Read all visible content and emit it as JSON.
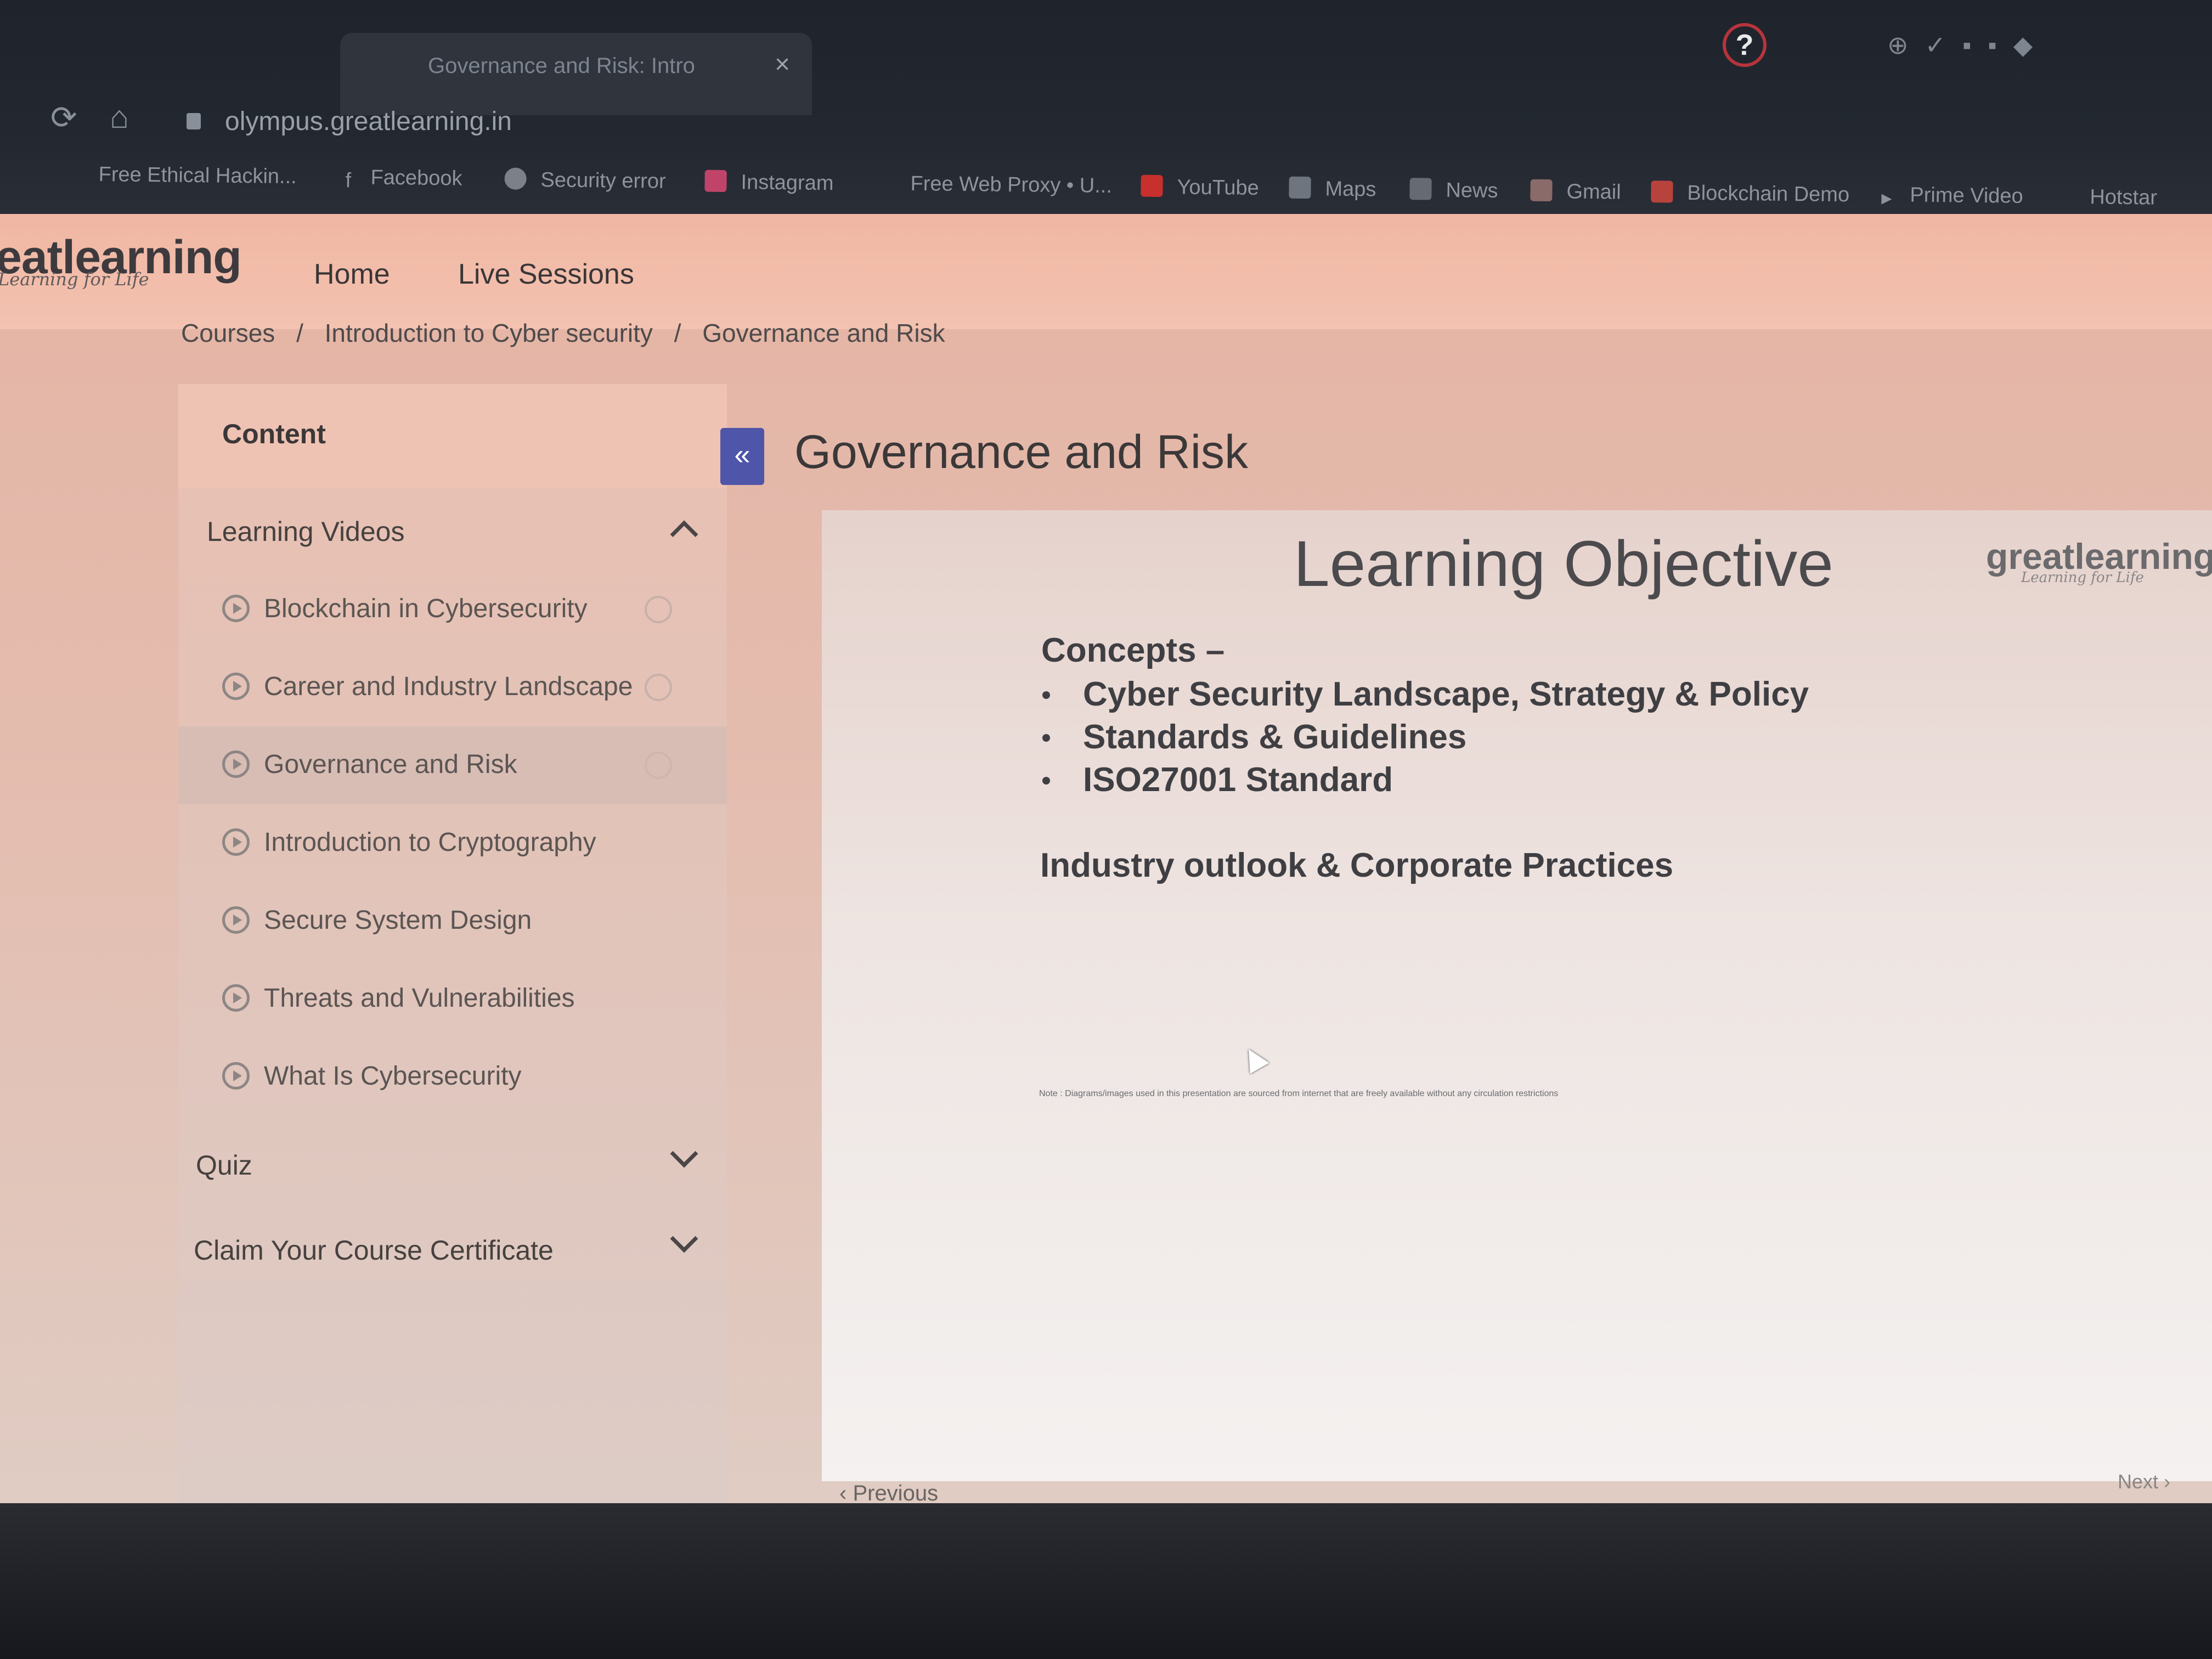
{
  "browser": {
    "tab_title": "Governance and Risk: Intro",
    "tab_close": "×",
    "url": "olympus.greatlearning.in",
    "bookmarks": [
      "Free Ethical Hackin...",
      "Facebook",
      "Security error",
      "Instagram",
      "Free Web Proxy • U...",
      "YouTube",
      "Maps",
      "News",
      "Gmail",
      "Blockchain Demo",
      "Prime Video",
      "Hotstar"
    ]
  },
  "header": {
    "logo": "eatlearning",
    "logo_tagline": "Learning for Life",
    "nav": [
      "Home",
      "Live Sessions"
    ]
  },
  "breadcrumb": [
    "Courses",
    "/",
    "Introduction to Cyber security",
    "/",
    "Governance and Risk"
  ],
  "sidebar": {
    "content_title": "Content",
    "sections": [
      {
        "title": "Learning Videos",
        "expanded": true
      },
      {
        "title": "Quiz",
        "expanded": false
      },
      {
        "title": "Claim Your Course Certificate",
        "expanded": false
      }
    ],
    "videos": [
      {
        "label": "Blockchain in Cybersecurity"
      },
      {
        "label": "Career and Industry Landscape"
      },
      {
        "label": "Governance and Risk",
        "active": true
      },
      {
        "label": "Introduction to Cryptography"
      },
      {
        "label": "Secure System Design"
      },
      {
        "label": "Threats and Vulnerabilities"
      },
      {
        "label": "What Is Cybersecurity"
      }
    ]
  },
  "main": {
    "collapse_icon": "«",
    "title": "Governance and Risk",
    "slide": {
      "heading": "Learning Objective",
      "logo": "greatlearning",
      "logo_tagline": "Learning for Life",
      "concepts_label": "Concepts –",
      "bullets": [
        "Cyber Security Landscape, Strategy & Policy",
        "Standards & Guidelines",
        "ISO27001 Standard"
      ],
      "industry": "Industry outlook & Corporate Practices",
      "note": "Note : Diagrams/images used in this presentation are sourced from internet that are freely available without any circulation restrictions"
    },
    "prev": "Previous",
    "next": "Next"
  },
  "colors": {
    "accent": "#4f55a8",
    "header_bg": "#f0b7a3",
    "browser_bg": "#1f232b"
  }
}
